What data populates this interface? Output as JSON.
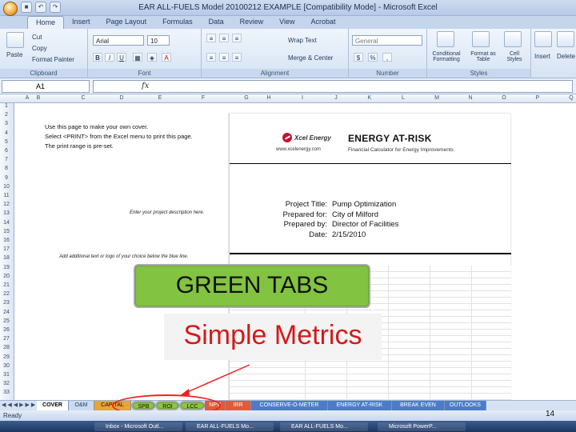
{
  "window": {
    "title": "EAR ALL-FUELS Model 20100212 EXAMPLE [Compatibility Mode] - Microsoft Excel"
  },
  "ribbon_tabs": [
    "Home",
    "Insert",
    "Page Layout",
    "Formulas",
    "Data",
    "Review",
    "View",
    "Acrobat"
  ],
  "clipboard": {
    "paste": "Paste",
    "cut": "Cut",
    "copy": "Copy",
    "format_painter": "Format Painter",
    "label": "Clipboard"
  },
  "font": {
    "name": "Arial",
    "size": "10",
    "label": "Font"
  },
  "alignment": {
    "wrap": "Wrap Text",
    "merge": "Merge & Center",
    "label": "Alignment"
  },
  "number": {
    "format": "General",
    "label": "Number"
  },
  "styles": {
    "conditional": "Conditional Formatting",
    "format_table": "Format as Table",
    "cell_styles": "Cell Styles",
    "label": "Styles"
  },
  "cells": {
    "insert": "Insert",
    "delete": "Delete"
  },
  "formula_bar": {
    "cell": "A1",
    "fx": "fx"
  },
  "columns": [
    "A",
    "B",
    "C",
    "D",
    "E",
    "F",
    "G",
    "H",
    "I",
    "J",
    "K",
    "L",
    "M",
    "N",
    "O",
    "P",
    "Q"
  ],
  "rows": [
    "1",
    "2",
    "3",
    "4",
    "5",
    "6",
    "7",
    "8",
    "9",
    "10",
    "11",
    "12",
    "13",
    "14",
    "15",
    "16",
    "17",
    "18",
    "19",
    "20",
    "21",
    "22",
    "23",
    "24",
    "25",
    "26",
    "27",
    "28",
    "29",
    "30",
    "31",
    "32",
    "33"
  ],
  "instructions": [
    "Use this page to make your own cover.",
    "Select <PRINT> from the Excel menu to print this page.",
    "The print range is pre-set."
  ],
  "notes": {
    "project_desc": "Enter your project description here.",
    "add_text": "Add additional text or logo of your choice below the blue line."
  },
  "cover": {
    "logo_text": "Xcel Energy",
    "url": "www.xcelenergy.com",
    "title": "ENERGY AT-RISK",
    "subtitle": "Financial Calculator for Energy Improvements",
    "fields": [
      {
        "k": "Project Title:",
        "v": "Pump Optimization"
      },
      {
        "k": "Prepared for:",
        "v": "City of Milford"
      },
      {
        "k": "Prepared by:",
        "v": "Director of Facilities"
      },
      {
        "k": "Date:",
        "v": "2/15/2010"
      }
    ]
  },
  "overlay": {
    "green_tabs": "GREEN TABS",
    "simple_metrics": "Simple Metrics"
  },
  "sheet_tabs": [
    "COVER",
    "O&M",
    "CAPITAL",
    "SPB",
    "ROI",
    "LCC",
    "NPV",
    "IRR",
    "CONSERVE-O-METER",
    "ENERGY AT-RISK",
    "BREAK EVEN",
    "OUTLOOKS"
  ],
  "status": {
    "text": "Ready"
  },
  "taskbar": [
    "Inbox - Microsoft Outl...",
    "EAR ALL-FUELS Mo...",
    "EAR ALL-FUELS Mo...",
    "Microsoft PowerP..."
  ],
  "slide": {
    "page_number": "14"
  },
  "colors": {
    "green_tab": "#82c341",
    "metric_red": "#d4191a",
    "highlight_ellipse": "#ee2222"
  }
}
